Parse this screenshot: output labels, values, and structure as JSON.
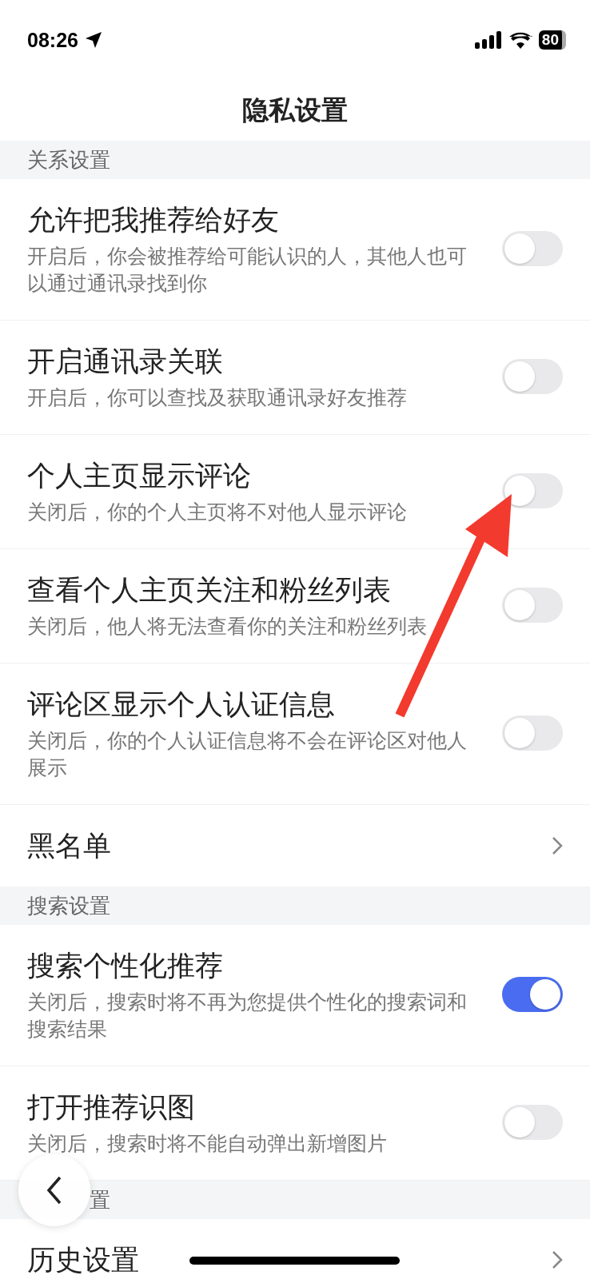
{
  "status_bar": {
    "time": "08:26",
    "battery": "80"
  },
  "title": "隐私设置",
  "sections": [
    {
      "header": "关系设置",
      "items": [
        {
          "kind": "toggle",
          "title": "允许把我推荐给好友",
          "subtitle": "开启后，你会被推荐给可能认识的人，其他人也可以通过通讯录找到你",
          "on": false
        },
        {
          "kind": "toggle",
          "title": "开启通讯录关联",
          "subtitle": "开启后，你可以查找及获取通讯录好友推荐",
          "on": false
        },
        {
          "kind": "toggle",
          "title": "个人主页显示评论",
          "subtitle": "关闭后，你的个人主页将不对他人显示评论",
          "on": false
        },
        {
          "kind": "toggle",
          "title": "查看个人主页关注和粉丝列表",
          "subtitle": "关闭后，他人将无法查看你的关注和粉丝列表",
          "on": false
        },
        {
          "kind": "toggle",
          "title": "评论区显示个人认证信息",
          "subtitle": "关闭后，你的个人认证信息将不会在评论区对他人展示",
          "on": false
        },
        {
          "kind": "link",
          "title": "黑名单"
        }
      ]
    },
    {
      "header": "搜索设置",
      "items": [
        {
          "kind": "toggle",
          "title": "搜索个性化推荐",
          "subtitle": "关闭后，搜索时将不再为您提供个性化的搜索词和搜索结果",
          "on": true
        },
        {
          "kind": "toggle",
          "title": "打开推荐识图",
          "subtitle": "关闭后，搜索时将不能自动弹出新增图片",
          "on": false
        }
      ]
    },
    {
      "header": "置",
      "items": [
        {
          "kind": "link",
          "title": "历史设置"
        }
      ]
    }
  ]
}
